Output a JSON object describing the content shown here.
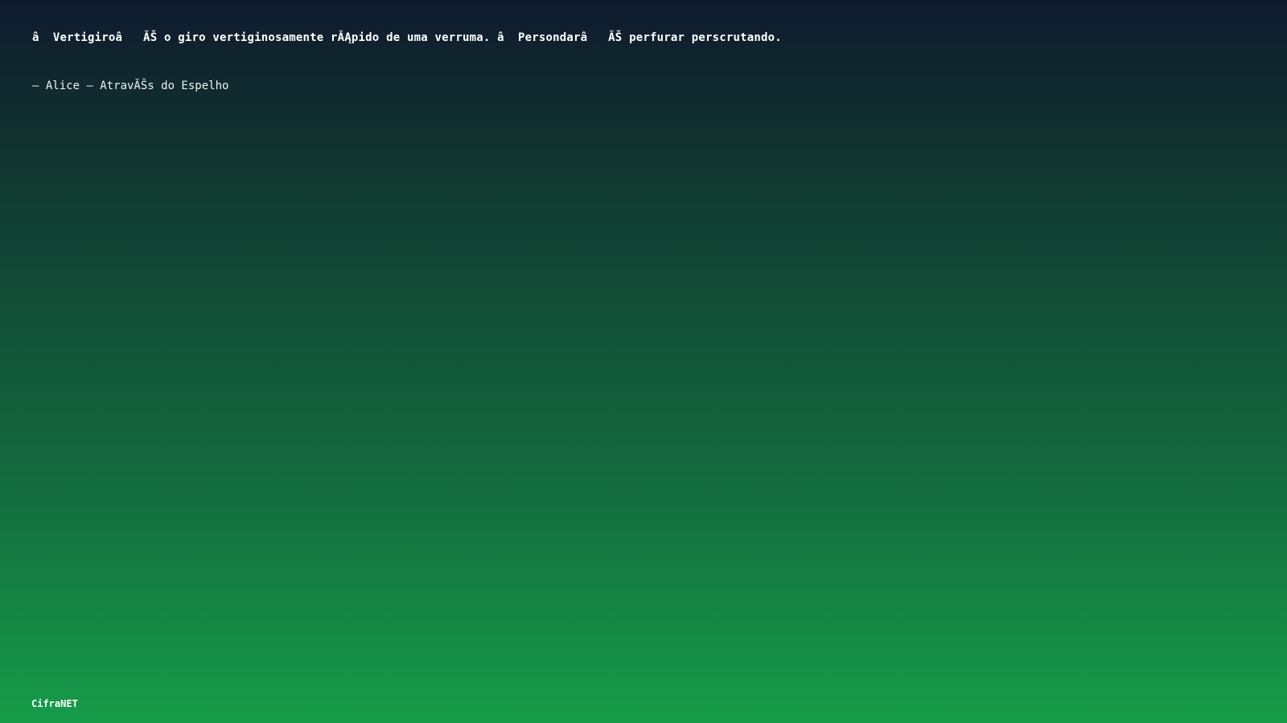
{
  "quote": {
    "text": "â  Vertigiroâ   ĂŠ o giro vertiginosamente rĂĄpido de uma verruma. â  Persondarâ   ĂŠ perfurar perscrutando."
  },
  "source": {
    "text": "– Alice – AtravĂŠs do Espelho"
  },
  "brand": {
    "label": "CifraNET"
  }
}
